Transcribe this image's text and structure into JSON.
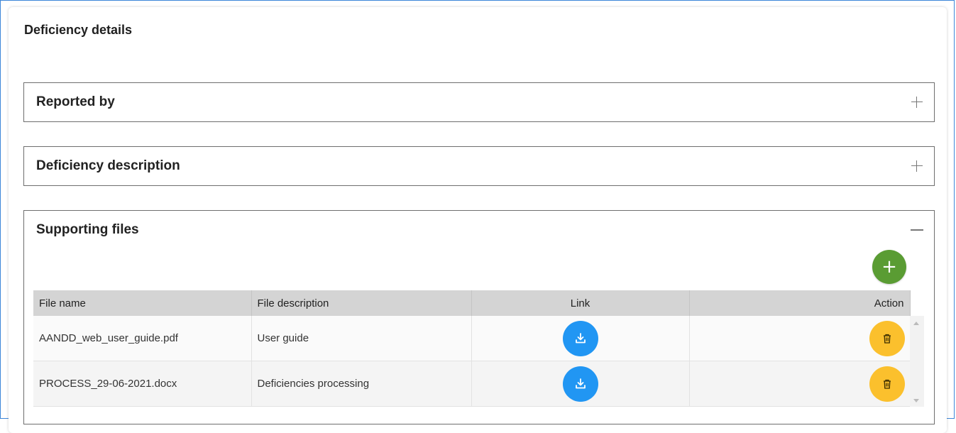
{
  "card": {
    "title": "Deficiency details"
  },
  "panels": {
    "reported_by": {
      "title": "Reported by",
      "state": "collapsed",
      "toggle_icon": "plus-icon"
    },
    "description": {
      "title": "Deficiency description",
      "state": "collapsed",
      "toggle_icon": "plus-icon"
    },
    "supporting_files": {
      "title": "Supporting files",
      "state": "expanded",
      "toggle_icon": "minus-icon"
    }
  },
  "files_table": {
    "add_button_icon": "plus-icon",
    "add_button_glyph": "+",
    "columns": {
      "file_name": "File name",
      "file_description": "File description",
      "link": "Link",
      "action": "Action"
    },
    "rows": [
      {
        "file_name": "AANDD_web_user_guide.pdf",
        "file_description": "User guide",
        "link_icon": "download-icon",
        "action_icon": "trash-icon"
      },
      {
        "file_name": "PROCESS_29-06-2021.docx",
        "file_description": "Deficiencies processing",
        "link_icon": "download-icon",
        "action_icon": "trash-icon"
      }
    ]
  },
  "colors": {
    "add_button": "#5a9c33",
    "download_button": "#2196f3",
    "delete_button": "#fbc02d",
    "header_background": "#d4d4d4",
    "frame_border": "#3d86d8"
  }
}
